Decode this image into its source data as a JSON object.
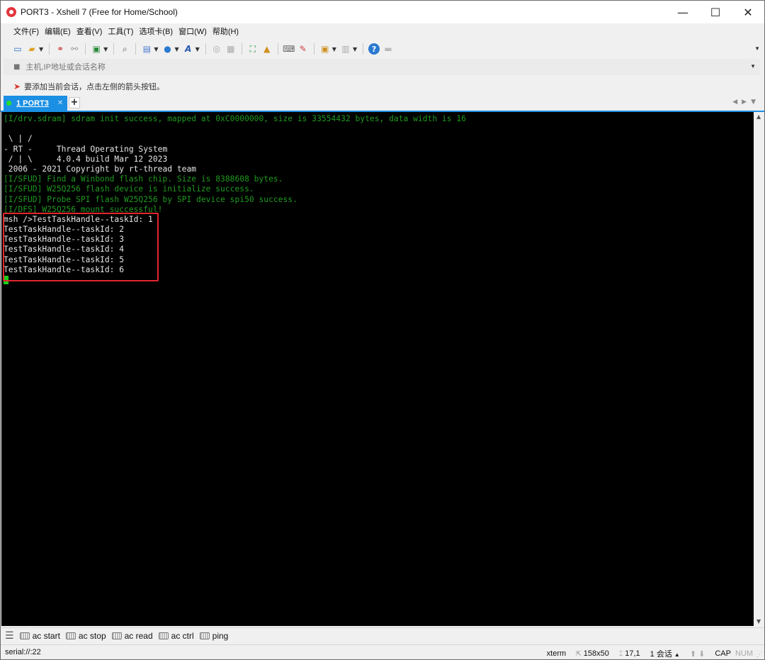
{
  "window": {
    "title": "PORT3 - Xshell 7 (Free for Home/School)",
    "minimize": "—",
    "maximize": "☐",
    "close": "✕"
  },
  "menu": [
    "文件(F)",
    "编辑(E)",
    "查看(V)",
    "工具(T)",
    "选项卡(B)",
    "窗口(W)",
    "帮助(H)"
  ],
  "address": {
    "placeholder": "主机,IP地址或会话名称"
  },
  "tip": {
    "text": "要添加当前会话，点击左侧的箭头按钮。"
  },
  "tab": {
    "label": "1 PORT3",
    "add": "+"
  },
  "terminal": {
    "lines": [
      {
        "text": "[I/drv.sdram] sdram init success, mapped at 0xC0000000, size is 33554432 bytes, data width is 16",
        "style": "dim"
      },
      {
        "text": "",
        "style": "bright"
      },
      {
        "text": " \\ | /",
        "style": "bright"
      },
      {
        "text": "- RT -     Thread Operating System",
        "style": "bright"
      },
      {
        "text": " / | \\     4.0.4 build Mar 12 2023",
        "style": "bright"
      },
      {
        "text": " 2006 - 2021 Copyright by rt-thread team",
        "style": "bright"
      },
      {
        "text": "[I/SFUD] Find a Winbond flash chip. Size is 8388608 bytes.",
        "style": "dim"
      },
      {
        "text": "[I/SFUD] W25Q256 flash device is initialize success.",
        "style": "dim"
      },
      {
        "text": "[I/SFUD] Probe SPI flash W25Q256 by SPI device spi50 success.",
        "style": "dim"
      },
      {
        "text": "[I/DFS] W25Q256 mount successful!",
        "style": "dim"
      },
      {
        "text": "msh />TestTaskHandle--taskId: 1",
        "style": "bright"
      },
      {
        "text": "TestTaskHandle--taskId: 2",
        "style": "bright"
      },
      {
        "text": "TestTaskHandle--taskId: 3",
        "style": "bright"
      },
      {
        "text": "TestTaskHandle--taskId: 4",
        "style": "bright"
      },
      {
        "text": "TestTaskHandle--taskId: 5",
        "style": "bright"
      },
      {
        "text": "TestTaskHandle--taskId: 6",
        "style": "bright"
      }
    ]
  },
  "quickbar": {
    "buttons": [
      "ac start",
      "ac stop",
      "ac read",
      "ac ctrl",
      "ping"
    ]
  },
  "status": {
    "connection": "serial://:22",
    "terminal_type": "xterm",
    "size": "158x50",
    "cursor": "17,1",
    "sessions": "1 会话",
    "caps": "CAP",
    "num": "NUM"
  },
  "colors": {
    "accent": "#1a8fe3",
    "terminal_bg": "#000000",
    "terminal_dim": "#1f9a1f",
    "highlight": "#e3262d"
  }
}
